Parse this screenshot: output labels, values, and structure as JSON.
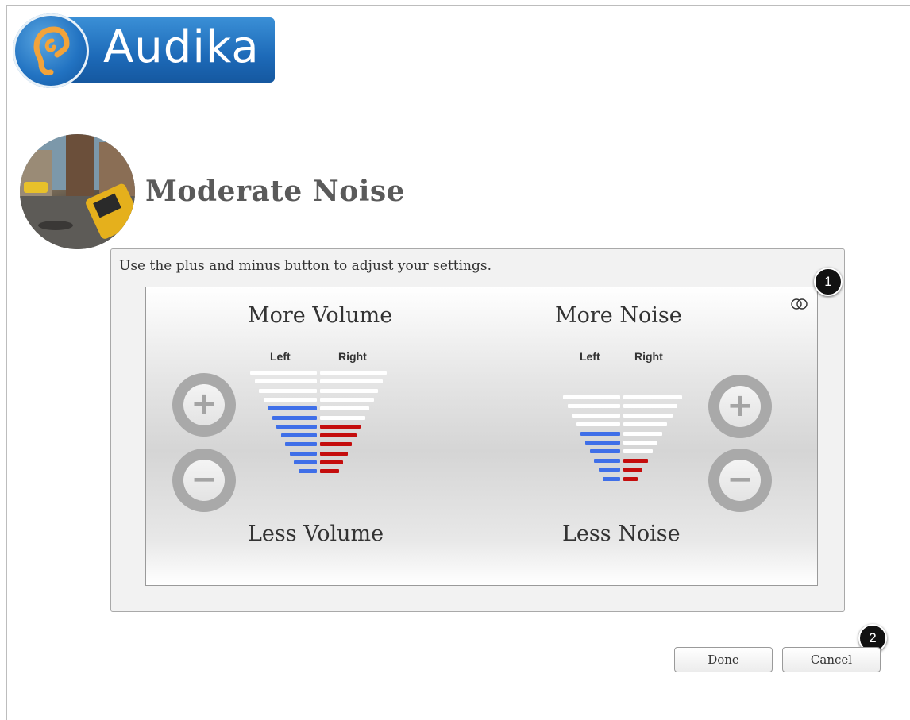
{
  "brand": {
    "name": "Audika",
    "primary_color": "#1d6ab8",
    "icon": "ear-icon"
  },
  "page": {
    "title": "Moderate Noise",
    "avatar": "street-scene-photo"
  },
  "panel": {
    "instruction": "Use the plus and minus button to adjust your settings.",
    "link_icon": "link-rings-icon",
    "volume": {
      "top_label": "More Volume",
      "bottom_label": "Less Volume",
      "left_label": "Left",
      "right_label": "Right",
      "plus_icon": "plus-icon",
      "minus_icon": "minus-icon",
      "left_level": 8,
      "right_level": 6,
      "total_steps": 12
    },
    "noise": {
      "top_label": "More Noise",
      "bottom_label": "Less Noise",
      "left_label": "Left",
      "right_label": "Right",
      "plus_icon": "plus-icon",
      "minus_icon": "minus-icon",
      "left_level": 6,
      "right_level": 3,
      "total_steps": 10
    },
    "colors": {
      "left_active": "#3f6fe8",
      "right_active": "#c40d0d",
      "inactive": "#ffffff"
    }
  },
  "callouts": {
    "one": "1",
    "two": "2"
  },
  "actions": {
    "done": "Done",
    "cancel": "Cancel"
  }
}
